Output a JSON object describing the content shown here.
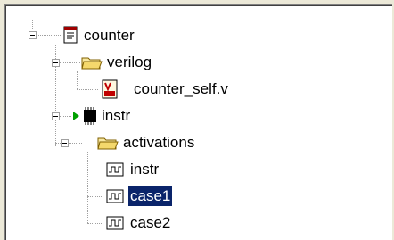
{
  "tree": {
    "nodes": [
      {
        "label": "counter",
        "icon": "document-icon"
      },
      {
        "label": "verilog",
        "icon": "folder-icon"
      },
      {
        "label": "counter_self.v",
        "icon": "verilog-file-icon"
      },
      {
        "label": "instr",
        "icon": "chip-icon"
      },
      {
        "label": "activations",
        "icon": "folder-icon"
      },
      {
        "label": "instr",
        "icon": "waveform-icon"
      },
      {
        "label": "case1",
        "icon": "waveform-icon",
        "selected": true
      },
      {
        "label": "case2",
        "icon": "waveform-icon"
      }
    ]
  },
  "colors": {
    "selection": "#0A246A",
    "background": "#FFFFFF",
    "chrome": "#ECE9D8"
  }
}
